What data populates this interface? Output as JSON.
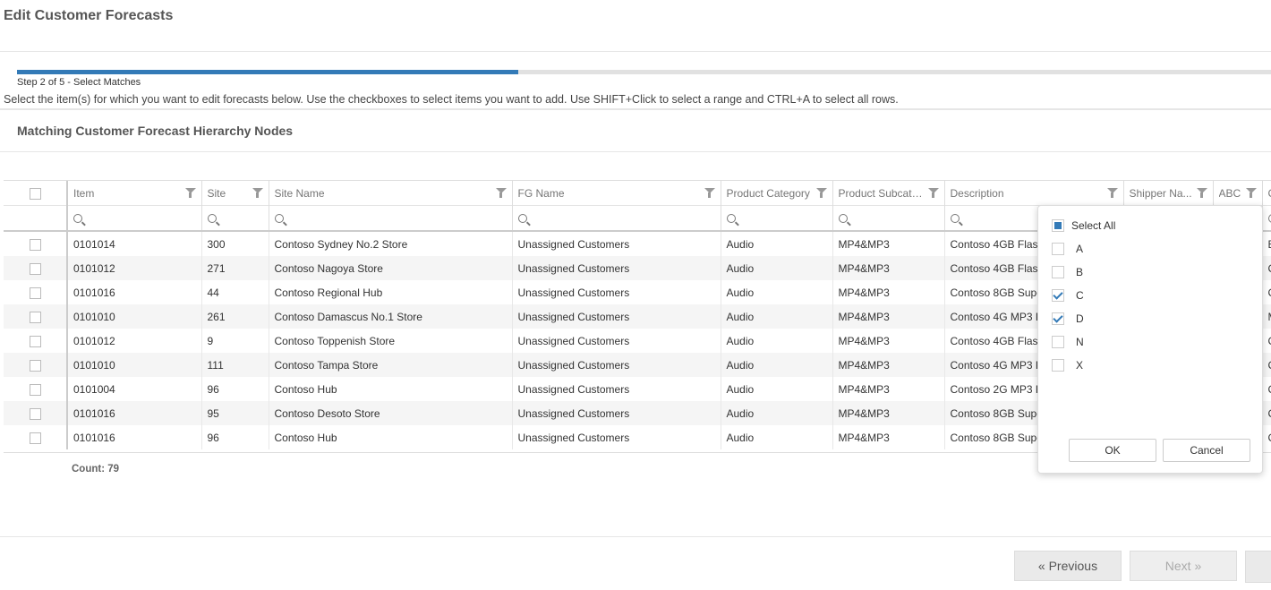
{
  "page": {
    "title": "Edit Customer Forecasts"
  },
  "wizard": {
    "step_text": "Step 2 of 5 - Select Matches",
    "progress_fraction": 0.4
  },
  "instructions": "Select the item(s) for which you want to edit forecasts below. Use the checkboxes to select items you want to add. Use SHIFT+Click to select a range and CTRL+A to select all rows.",
  "section_title": "Matching Customer Forecast Hierarchy Nodes",
  "grid": {
    "columns": [
      "Item",
      "Site",
      "Site Name",
      "FG Name",
      "Product Category",
      "Product Subcate...",
      "Description",
      "Shipper Na...",
      "ABC",
      "C"
    ],
    "rows": [
      [
        "0101014",
        "300",
        "Contoso Sydney No.2 Store",
        "Unassigned Customers",
        "Audio",
        "MP4&MP3",
        "Contoso 4GB Flash",
        "",
        "",
        "E"
      ],
      [
        "0101012",
        "271",
        "Contoso Nagoya Store",
        "Unassigned Customers",
        "Audio",
        "MP4&MP3",
        "Contoso 4GB Flash",
        "",
        "",
        "C"
      ],
      [
        "0101016",
        "44",
        "Contoso Regional Hub",
        "Unassigned Customers",
        "Audio",
        "MP4&MP3",
        "Contoso 8GB Supe",
        "",
        "",
        "C"
      ],
      [
        "0101010",
        "261",
        "Contoso Damascus No.1 Store",
        "Unassigned Customers",
        "Audio",
        "MP4&MP3",
        "Contoso 4G MP3 P",
        "",
        "",
        "M"
      ],
      [
        "0101012",
        "9",
        "Contoso Toppenish Store",
        "Unassigned Customers",
        "Audio",
        "MP4&MP3",
        "Contoso 4GB Flash",
        "",
        "",
        "C"
      ],
      [
        "0101010",
        "111",
        "Contoso Tampa Store",
        "Unassigned Customers",
        "Audio",
        "MP4&MP3",
        "Contoso 4G MP3 P",
        "",
        "",
        "C"
      ],
      [
        "0101004",
        "96",
        "Contoso Hub",
        "Unassigned Customers",
        "Audio",
        "MP4&MP3",
        "Contoso 2G MP3 P",
        "",
        "",
        "C"
      ],
      [
        "0101016",
        "95",
        "Contoso Desoto Store",
        "Unassigned Customers",
        "Audio",
        "MP4&MP3",
        "Contoso 8GB Supe",
        "",
        "",
        "C"
      ],
      [
        "0101016",
        "96",
        "Contoso Hub",
        "Unassigned Customers",
        "Audio",
        "MP4&MP3",
        "Contoso 8GB Supe",
        "",
        "",
        "C"
      ]
    ],
    "count_label": "Count: 79"
  },
  "filter_popup": {
    "select_all_label": "Select All",
    "select_all_state": "partial",
    "options": [
      {
        "label": "A",
        "checked": false
      },
      {
        "label": "B",
        "checked": false
      },
      {
        "label": "C",
        "checked": true
      },
      {
        "label": "D",
        "checked": true
      },
      {
        "label": "N",
        "checked": false
      },
      {
        "label": "X",
        "checked": false
      }
    ],
    "ok_label": "OK",
    "cancel_label": "Cancel"
  },
  "footer": {
    "previous_label": "« Previous",
    "next_label": "Next »"
  },
  "colors": {
    "accent": "#337ab7",
    "progress_track": "#e1e1e1",
    "row_alt": "#f5f5f5"
  },
  "icons": {
    "filter": "funnel-icon",
    "search": "search-icon",
    "check": "checkmark-icon"
  }
}
